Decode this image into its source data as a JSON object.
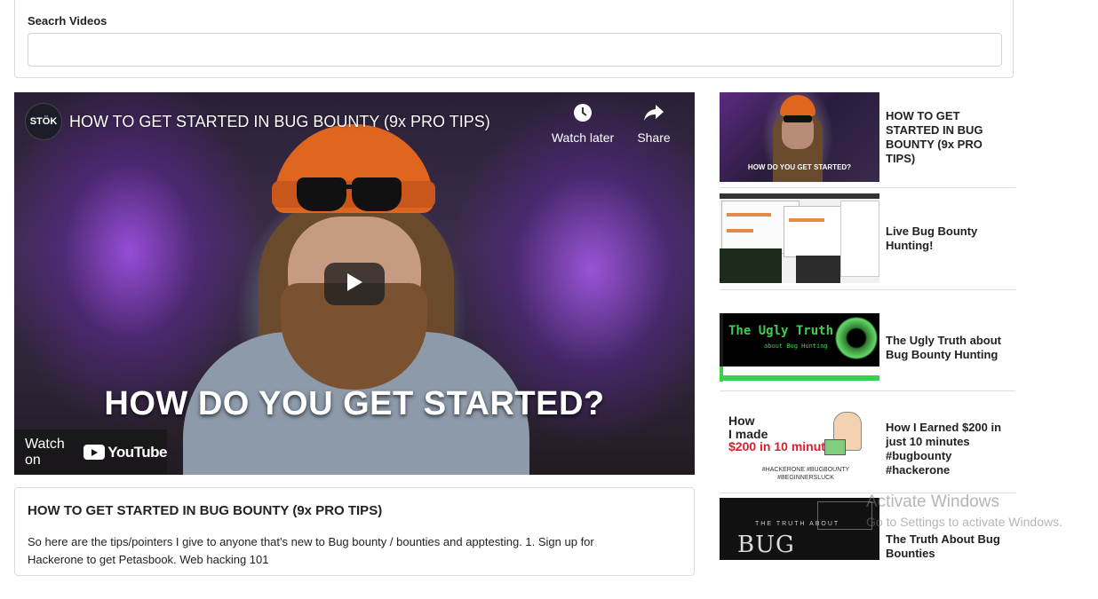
{
  "search": {
    "label": "Seacrh Videos",
    "placeholder": "",
    "value": ""
  },
  "player": {
    "channel_badge": "STÖK",
    "title": "HOW TO GET STARTED IN BUG BOUNTY (9x PRO TIPS)",
    "watch_later": "Watch later",
    "share": "Share",
    "overlay_caption": "HOW DO YOU GET STARTED?",
    "watch_on": "Watch on",
    "youtube": "YouTube"
  },
  "description": {
    "title": "HOW TO GET STARTED IN BUG BOUNTY (9x PRO TIPS)",
    "text": "So here are the tips/pointers I give to anyone that's new to Bug bounty / bounties and apptesting. 1. Sign up for Hackerone to get Petasbook. Web hacking 101"
  },
  "playlist": [
    {
      "title": "HOW TO GET STARTED IN BUG BOUNTY (9x PRO TIPS)",
      "thumb_caption": "HOW DO YOU GET STARTED?"
    },
    {
      "title": "Live Bug Bounty Hunting!"
    },
    {
      "title": "The Ugly Truth about Bug Bounty Hunting",
      "thumb_text": "The Ugly Truth",
      "thumb_sub": "about Bug Hunting"
    },
    {
      "title": "How I Earned $200 in just 10 minutes #bugbounty #hackerone",
      "thumb_l1": "How",
      "thumb_l2": "I made",
      "thumb_l3": "$200 in 10 minutes",
      "thumb_tags": "#HACKERONE #BUGBOUNTY #BEGINNERSLUCK"
    },
    {
      "title": "The Truth About Bug Bounties",
      "thumb_l1": "THE TRUTH ABOUT",
      "thumb_l2": "BUG BOUNTIES"
    }
  ],
  "watermark": {
    "line1": "Activate Windows",
    "line2": "Go to Settings to activate Windows."
  }
}
